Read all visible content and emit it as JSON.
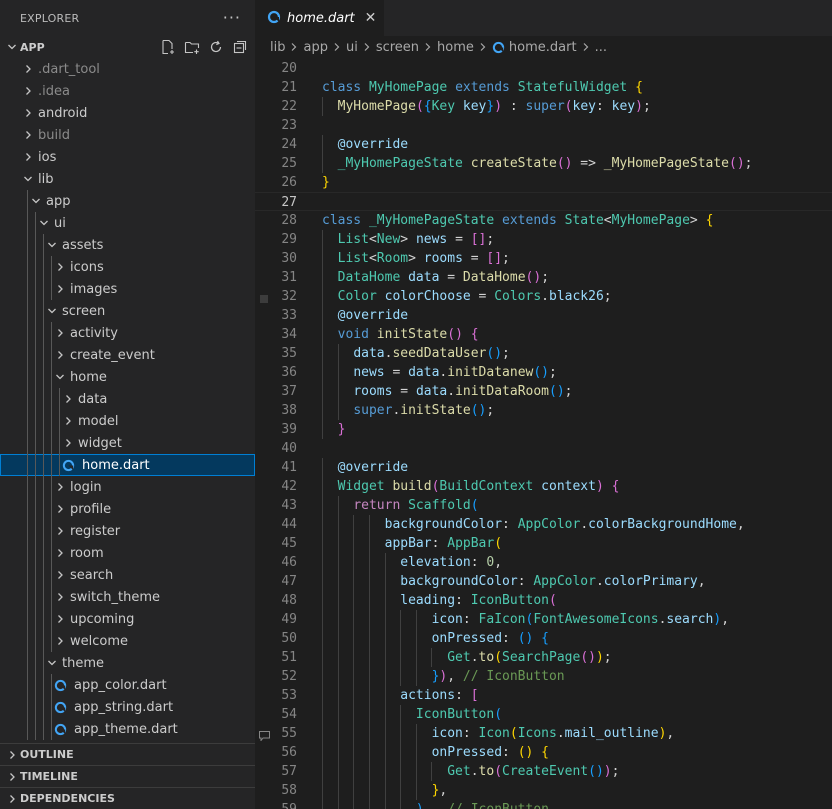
{
  "explorer": {
    "title": "EXPLORER",
    "more_label": "···",
    "root_label": "APP"
  },
  "tree": [
    {
      "label": ".dart_tool",
      "depth": 0,
      "kind": "folder",
      "expanded": false,
      "dim": true,
      "name": "tree-item-dart-tool"
    },
    {
      "label": ".idea",
      "depth": 0,
      "kind": "folder",
      "expanded": false,
      "dim": true,
      "name": "tree-item-idea"
    },
    {
      "label": "android",
      "depth": 0,
      "kind": "folder",
      "expanded": false,
      "dim": false,
      "name": "tree-item-android"
    },
    {
      "label": "build",
      "depth": 0,
      "kind": "folder",
      "expanded": false,
      "dim": true,
      "name": "tree-item-build"
    },
    {
      "label": "ios",
      "depth": 0,
      "kind": "folder",
      "expanded": false,
      "dim": false,
      "name": "tree-item-ios"
    },
    {
      "label": "lib",
      "depth": 0,
      "kind": "folder",
      "expanded": true,
      "dim": false,
      "name": "tree-item-lib"
    },
    {
      "label": "app",
      "depth": 1,
      "kind": "folder",
      "expanded": true,
      "dim": false,
      "name": "tree-item-app"
    },
    {
      "label": "ui",
      "depth": 2,
      "kind": "folder",
      "expanded": true,
      "dim": false,
      "name": "tree-item-ui"
    },
    {
      "label": "assets",
      "depth": 3,
      "kind": "folder",
      "expanded": true,
      "dim": false,
      "name": "tree-item-assets"
    },
    {
      "label": "icons",
      "depth": 4,
      "kind": "folder",
      "expanded": false,
      "dim": false,
      "name": "tree-item-icons"
    },
    {
      "label": "images",
      "depth": 4,
      "kind": "folder",
      "expanded": false,
      "dim": false,
      "name": "tree-item-images"
    },
    {
      "label": "screen",
      "depth": 3,
      "kind": "folder",
      "expanded": true,
      "dim": false,
      "name": "tree-item-screen"
    },
    {
      "label": "activity",
      "depth": 4,
      "kind": "folder",
      "expanded": false,
      "dim": false,
      "name": "tree-item-activity"
    },
    {
      "label": "create_event",
      "depth": 4,
      "kind": "folder",
      "expanded": false,
      "dim": false,
      "name": "tree-item-create-event"
    },
    {
      "label": "home",
      "depth": 4,
      "kind": "folder",
      "expanded": true,
      "dim": false,
      "name": "tree-item-home"
    },
    {
      "label": "data",
      "depth": 5,
      "kind": "folder",
      "expanded": false,
      "dim": false,
      "name": "tree-item-data"
    },
    {
      "label": "model",
      "depth": 5,
      "kind": "folder",
      "expanded": false,
      "dim": false,
      "name": "tree-item-model"
    },
    {
      "label": "widget",
      "depth": 5,
      "kind": "folder",
      "expanded": false,
      "dim": false,
      "name": "tree-item-widget"
    },
    {
      "label": "home.dart",
      "depth": 5,
      "kind": "file",
      "selected": true,
      "dim": false,
      "name": "tree-item-home-dart"
    },
    {
      "label": "login",
      "depth": 4,
      "kind": "folder",
      "expanded": false,
      "dim": false,
      "name": "tree-item-login"
    },
    {
      "label": "profile",
      "depth": 4,
      "kind": "folder",
      "expanded": false,
      "dim": false,
      "name": "tree-item-profile"
    },
    {
      "label": "register",
      "depth": 4,
      "kind": "folder",
      "expanded": false,
      "dim": false,
      "name": "tree-item-register"
    },
    {
      "label": "room",
      "depth": 4,
      "kind": "folder",
      "expanded": false,
      "dim": false,
      "name": "tree-item-room"
    },
    {
      "label": "search",
      "depth": 4,
      "kind": "folder",
      "expanded": false,
      "dim": false,
      "name": "tree-item-search"
    },
    {
      "label": "switch_theme",
      "depth": 4,
      "kind": "folder",
      "expanded": false,
      "dim": false,
      "name": "tree-item-switch-theme"
    },
    {
      "label": "upcoming",
      "depth": 4,
      "kind": "folder",
      "expanded": false,
      "dim": false,
      "name": "tree-item-upcoming"
    },
    {
      "label": "welcome",
      "depth": 4,
      "kind": "folder",
      "expanded": false,
      "dim": false,
      "name": "tree-item-welcome"
    },
    {
      "label": "theme",
      "depth": 3,
      "kind": "folder",
      "expanded": true,
      "dim": false,
      "name": "tree-item-theme"
    },
    {
      "label": "app_color.dart",
      "depth": 4,
      "kind": "file",
      "dim": false,
      "name": "tree-item-app-color-dart"
    },
    {
      "label": "app_string.dart",
      "depth": 4,
      "kind": "file",
      "dim": false,
      "name": "tree-item-app-string-dart"
    },
    {
      "label": "app_theme.dart",
      "depth": 4,
      "kind": "file",
      "dim": false,
      "name": "tree-item-app-theme-dart"
    }
  ],
  "panels": [
    {
      "label": "OUTLINE",
      "name": "outline-panel-header"
    },
    {
      "label": "TIMELINE",
      "name": "timeline-panel-header"
    },
    {
      "label": "DEPENDENCIES",
      "name": "dependencies-panel-header"
    }
  ],
  "tab": {
    "label": "home.dart",
    "close_label": "✕"
  },
  "breadcrumb": [
    "lib",
    "app",
    "ui",
    "screen",
    "home",
    "home.dart",
    "..."
  ],
  "colors": {
    "accent": "#007fd4",
    "selection": "#04395e",
    "dart_icon": "#42a5f5"
  },
  "icons": {
    "new_file": "new-file-icon",
    "new_folder": "new-folder-icon",
    "refresh": "refresh-icon",
    "collapse": "collapse-all-icon",
    "dart_file": "dart-file-icon",
    "chevron_right": "chevron-right-icon",
    "chevron_down": "chevron-down-icon"
  },
  "editor": {
    "first_line": 20,
    "active_line": 27,
    "gutter_marks": {
      "32": "breakpoint-hint-icon",
      "55": "comment-hint-icon"
    },
    "lines": [
      [],
      [
        [
          "class ",
          "kw"
        ],
        [
          "MyHomePage ",
          "type"
        ],
        [
          "extends ",
          "kw"
        ],
        [
          "StatefulWidget ",
          "type"
        ],
        [
          "{",
          "b1"
        ]
      ],
      [
        [
          "  "
        ],
        [
          "MyHomePage",
          "fn"
        ],
        [
          "(",
          "b2"
        ],
        [
          "{",
          "b3"
        ],
        [
          "Key ",
          "type"
        ],
        [
          "key",
          "var"
        ],
        [
          "}",
          "b3"
        ],
        [
          ")",
          "b2"
        ],
        [
          " : "
        ],
        [
          "super",
          "kw"
        ],
        [
          "(",
          "b2"
        ],
        [
          "key",
          "var"
        ],
        [
          ": "
        ],
        [
          "key",
          "var"
        ],
        [
          ")",
          "b2"
        ],
        [
          ";"
        ]
      ],
      [],
      [
        [
          "  "
        ],
        [
          "@override",
          "var"
        ]
      ],
      [
        [
          "  "
        ],
        [
          "_MyHomePageState ",
          "type"
        ],
        [
          "createState",
          "fn"
        ],
        [
          "()",
          "b2"
        ],
        [
          " => "
        ],
        [
          "_MyHomePageState",
          "fn"
        ],
        [
          "()",
          "b2"
        ],
        [
          ";"
        ]
      ],
      [
        [
          "}",
          "b1"
        ]
      ],
      [],
      [
        [
          "class ",
          "kw"
        ],
        [
          "_MyHomePageState ",
          "type"
        ],
        [
          "extends ",
          "kw"
        ],
        [
          "State",
          "type"
        ],
        [
          "<"
        ],
        [
          "MyHomePage",
          "type"
        ],
        [
          "> "
        ],
        [
          "{",
          "b1"
        ]
      ],
      [
        [
          "  "
        ],
        [
          "List",
          "type"
        ],
        [
          "<"
        ],
        [
          "New",
          "type"
        ],
        [
          "> "
        ],
        [
          "news",
          "var"
        ],
        [
          " = "
        ],
        [
          "[]",
          "b2"
        ],
        [
          ";"
        ]
      ],
      [
        [
          "  "
        ],
        [
          "List",
          "type"
        ],
        [
          "<"
        ],
        [
          "Room",
          "type"
        ],
        [
          "> "
        ],
        [
          "rooms",
          "var"
        ],
        [
          " = "
        ],
        [
          "[]",
          "b2"
        ],
        [
          ";"
        ]
      ],
      [
        [
          "  "
        ],
        [
          "DataHome ",
          "type"
        ],
        [
          "data",
          "var"
        ],
        [
          " = "
        ],
        [
          "DataHome",
          "fn"
        ],
        [
          "()",
          "b2"
        ],
        [
          ";"
        ]
      ],
      [
        [
          "  "
        ],
        [
          "Color ",
          "type"
        ],
        [
          "colorChoose",
          "var"
        ],
        [
          " = "
        ],
        [
          "Colors",
          "type"
        ],
        [
          "."
        ],
        [
          "black26",
          "var"
        ],
        [
          ";"
        ]
      ],
      [
        [
          "  "
        ],
        [
          "@override",
          "var"
        ]
      ],
      [
        [
          "  "
        ],
        [
          "void ",
          "kw"
        ],
        [
          "initState",
          "fn"
        ],
        [
          "()",
          "b2"
        ],
        [
          " "
        ],
        [
          "{",
          "b2"
        ]
      ],
      [
        [
          "    "
        ],
        [
          "data",
          "var"
        ],
        [
          "."
        ],
        [
          "seedDataUser",
          "fn"
        ],
        [
          "()",
          "b3"
        ],
        [
          ";"
        ]
      ],
      [
        [
          "    "
        ],
        [
          "news",
          "var"
        ],
        [
          " = "
        ],
        [
          "data",
          "var"
        ],
        [
          "."
        ],
        [
          "initDatanew",
          "fn"
        ],
        [
          "()",
          "b3"
        ],
        [
          ";"
        ]
      ],
      [
        [
          "    "
        ],
        [
          "rooms",
          "var"
        ],
        [
          " = "
        ],
        [
          "data",
          "var"
        ],
        [
          "."
        ],
        [
          "initDataRoom",
          "fn"
        ],
        [
          "()",
          "b3"
        ],
        [
          ";"
        ]
      ],
      [
        [
          "    "
        ],
        [
          "super",
          "kw"
        ],
        [
          "."
        ],
        [
          "initState",
          "fn"
        ],
        [
          "()",
          "b3"
        ],
        [
          ";"
        ]
      ],
      [
        [
          "  "
        ],
        [
          "}",
          "b2"
        ]
      ],
      [],
      [
        [
          "  "
        ],
        [
          "@override",
          "var"
        ]
      ],
      [
        [
          "  "
        ],
        [
          "Widget ",
          "type"
        ],
        [
          "build",
          "fn"
        ],
        [
          "(",
          "b2"
        ],
        [
          "BuildContext ",
          "type"
        ],
        [
          "context",
          "var"
        ],
        [
          ")",
          "b2"
        ],
        [
          " "
        ],
        [
          "{",
          "b2"
        ]
      ],
      [
        [
          "    "
        ],
        [
          "return ",
          "ctl"
        ],
        [
          "Scaffold",
          "type"
        ],
        [
          "(",
          "b3"
        ]
      ],
      [
        [
          "        "
        ],
        [
          "backgroundColor",
          "var"
        ],
        [
          ": "
        ],
        [
          "AppColor",
          "type"
        ],
        [
          "."
        ],
        [
          "colorBackgroundHome",
          "var"
        ],
        [
          ","
        ]
      ],
      [
        [
          "        "
        ],
        [
          "appBar",
          "var"
        ],
        [
          ": "
        ],
        [
          "AppBar",
          "type"
        ],
        [
          "(",
          "b1"
        ]
      ],
      [
        [
          "          "
        ],
        [
          "elevation",
          "var"
        ],
        [
          ": "
        ],
        [
          "0",
          "num"
        ],
        [
          ","
        ]
      ],
      [
        [
          "          "
        ],
        [
          "backgroundColor",
          "var"
        ],
        [
          ": "
        ],
        [
          "AppColor",
          "type"
        ],
        [
          "."
        ],
        [
          "colorPrimary",
          "var"
        ],
        [
          ","
        ]
      ],
      [
        [
          "          "
        ],
        [
          "leading",
          "var"
        ],
        [
          ": "
        ],
        [
          "IconButton",
          "type"
        ],
        [
          "(",
          "b2"
        ]
      ],
      [
        [
          "              "
        ],
        [
          "icon",
          "var"
        ],
        [
          ": "
        ],
        [
          "FaIcon",
          "type"
        ],
        [
          "(",
          "b3"
        ],
        [
          "FontAwesomeIcons",
          "type"
        ],
        [
          "."
        ],
        [
          "search",
          "var"
        ],
        [
          ")",
          "b3"
        ],
        [
          ","
        ]
      ],
      [
        [
          "              "
        ],
        [
          "onPressed",
          "var"
        ],
        [
          ": "
        ],
        [
          "()",
          "b3"
        ],
        [
          " "
        ],
        [
          "{",
          "b3"
        ]
      ],
      [
        [
          "                "
        ],
        [
          "Get",
          "type"
        ],
        [
          "."
        ],
        [
          "to",
          "fn"
        ],
        [
          "(",
          "b1"
        ],
        [
          "SearchPage",
          "type"
        ],
        [
          "()",
          "b2"
        ],
        [
          ")",
          "b1"
        ],
        [
          ";"
        ]
      ],
      [
        [
          "              "
        ],
        [
          "}",
          "b3"
        ],
        [
          ")",
          "b2"
        ],
        [
          ", "
        ],
        [
          "// IconButton",
          "com"
        ]
      ],
      [
        [
          "          "
        ],
        [
          "actions",
          "var"
        ],
        [
          ": "
        ],
        [
          "[",
          "b2"
        ]
      ],
      [
        [
          "            "
        ],
        [
          "IconButton",
          "type"
        ],
        [
          "(",
          "b3"
        ]
      ],
      [
        [
          "              "
        ],
        [
          "icon",
          "var"
        ],
        [
          ": "
        ],
        [
          "Icon",
          "type"
        ],
        [
          "(",
          "b1"
        ],
        [
          "Icons",
          "type"
        ],
        [
          "."
        ],
        [
          "mail_outline",
          "var"
        ],
        [
          ")",
          "b1"
        ],
        [
          ","
        ]
      ],
      [
        [
          "              "
        ],
        [
          "onPressed",
          "var"
        ],
        [
          ": "
        ],
        [
          "()",
          "b1"
        ],
        [
          " "
        ],
        [
          "{",
          "b1"
        ]
      ],
      [
        [
          "                "
        ],
        [
          "Get",
          "type"
        ],
        [
          "."
        ],
        [
          "to",
          "fn"
        ],
        [
          "(",
          "b2"
        ],
        [
          "CreateEvent",
          "type"
        ],
        [
          "()",
          "b3"
        ],
        [
          ")",
          "b2"
        ],
        [
          ";"
        ]
      ],
      [
        [
          "              "
        ],
        [
          "}",
          "b1"
        ],
        [
          ","
        ]
      ],
      [
        [
          "            "
        ],
        [
          "),",
          "b3"
        ],
        [
          "  "
        ],
        [
          "// IconButton",
          "com"
        ]
      ]
    ]
  }
}
